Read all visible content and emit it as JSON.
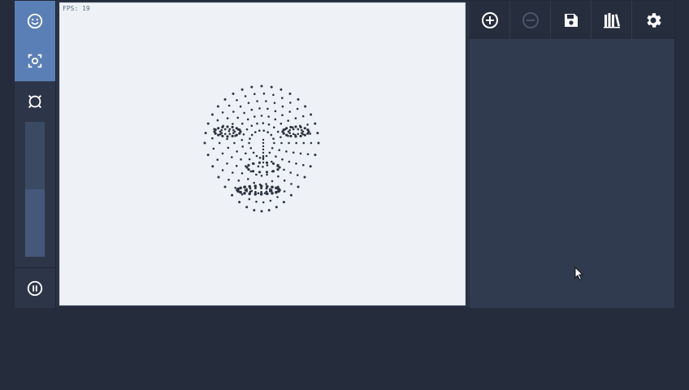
{
  "canvas": {
    "fps_label": "FPS: 19"
  },
  "left_toolbar": {
    "buttons": [
      {
        "icon": "smiley-icon",
        "active": true
      },
      {
        "icon": "face-scan-icon",
        "active": true
      },
      {
        "icon": "brightness-circle-icon",
        "active": false
      },
      {
        "icon": "pause-icon",
        "active": false
      }
    ],
    "slider_level": 0.5
  },
  "right_toolbar": {
    "buttons": [
      {
        "icon": "add-circle-icon",
        "enabled": true
      },
      {
        "icon": "remove-circle-icon",
        "enabled": false
      },
      {
        "icon": "save-icon",
        "enabled": true
      },
      {
        "icon": "library-icon",
        "enabled": true
      },
      {
        "icon": "gear-icon",
        "enabled": true
      }
    ]
  },
  "colors": {
    "background": "#252c3c",
    "accent": "#5a7fb6",
    "canvas": "#eef2f6",
    "landmarks": "#2d3340"
  }
}
